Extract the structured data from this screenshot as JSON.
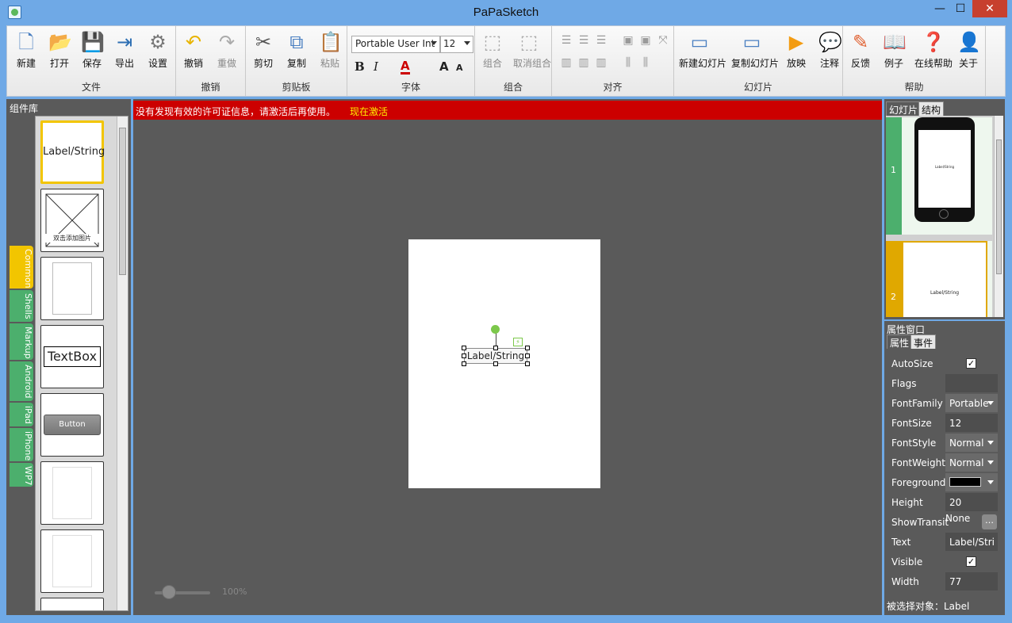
{
  "window": {
    "title": "PaPaSketch",
    "minimize": "—",
    "maximize": "☐",
    "close": "✕"
  },
  "ribbon": {
    "file": {
      "label": "文件",
      "new": "新建",
      "open": "打开",
      "save": "保存",
      "export": "导出",
      "settings": "设置"
    },
    "undo_group": {
      "label": "撤销",
      "undo": "撤销",
      "redo": "重做"
    },
    "clipboard": {
      "label": "剪贴板",
      "cut": "剪切",
      "copy": "复制",
      "paste": "粘贴"
    },
    "font": {
      "label": "字体",
      "family": "Portable User Int",
      "size": "12",
      "bold": "B",
      "italic": "I",
      "color": "A",
      "grow": "A",
      "shrink": "A"
    },
    "group": {
      "label": "组合",
      "group": "组合",
      "ungroup": "取消组合"
    },
    "align": {
      "label": "对齐"
    },
    "slides": {
      "label": "幻灯片",
      "new_slide": "新建幻灯片",
      "copy_slide": "复制幻灯片",
      "play": "放映",
      "annotate": "注释"
    },
    "help": {
      "label": "帮助",
      "feedback": "反馈",
      "examples": "例子",
      "online_help": "在线帮助",
      "about": "关于"
    }
  },
  "component_panel": {
    "title": "组件库",
    "items": [
      {
        "label": "Label/String"
      },
      {
        "label": "双击添加图片"
      },
      {
        "label": ""
      },
      {
        "label": "TextBox"
      },
      {
        "label": "Button"
      }
    ],
    "tabs": [
      "Common",
      "Shells",
      "Markup",
      "Android",
      "iPad",
      "iPhone",
      "WP7"
    ]
  },
  "canvas": {
    "license_message": "没有发现有效的许可证信息，请激活后再使用。",
    "activate_link": "现在激活",
    "element_text": "Label/String",
    "zoom": "100%"
  },
  "slides_panel": {
    "tab_slides": "幻灯片",
    "tab_structure": "结构",
    "slides": [
      {
        "number": "1"
      },
      {
        "number": "2",
        "text": "Label/String"
      }
    ],
    "slide1_text": "Label/String"
  },
  "props_panel": {
    "title": "属性窗口",
    "tab_props": "属性",
    "tab_events": "事件",
    "rows": [
      {
        "name": "AutoSize",
        "value": "✓",
        "kind": "check"
      },
      {
        "name": "Flags",
        "value": "",
        "kind": "text"
      },
      {
        "name": "FontFamily",
        "value": "Portable",
        "kind": "combo"
      },
      {
        "name": "FontSize",
        "value": "12",
        "kind": "text"
      },
      {
        "name": "FontStyle",
        "value": "Normal",
        "kind": "combo"
      },
      {
        "name": "FontWeight",
        "value": "Normal",
        "kind": "combo"
      },
      {
        "name": "Foreground",
        "value": "",
        "kind": "color"
      },
      {
        "name": "Height",
        "value": "20",
        "kind": "text"
      },
      {
        "name": "ShowTransit",
        "value": "None",
        "kind": "button"
      },
      {
        "name": "Text",
        "value": "Label/Stri",
        "kind": "text"
      },
      {
        "name": "Visible",
        "value": "✓",
        "kind": "check"
      },
      {
        "name": "Width",
        "value": "77",
        "kind": "text"
      }
    ],
    "selected_object": "被选择对象：Label"
  },
  "colors": {
    "accent": "#6fa9e6",
    "license_bar": "#cc0000",
    "tab_active": "#f2c500",
    "tab_green": "#4caf6d"
  }
}
